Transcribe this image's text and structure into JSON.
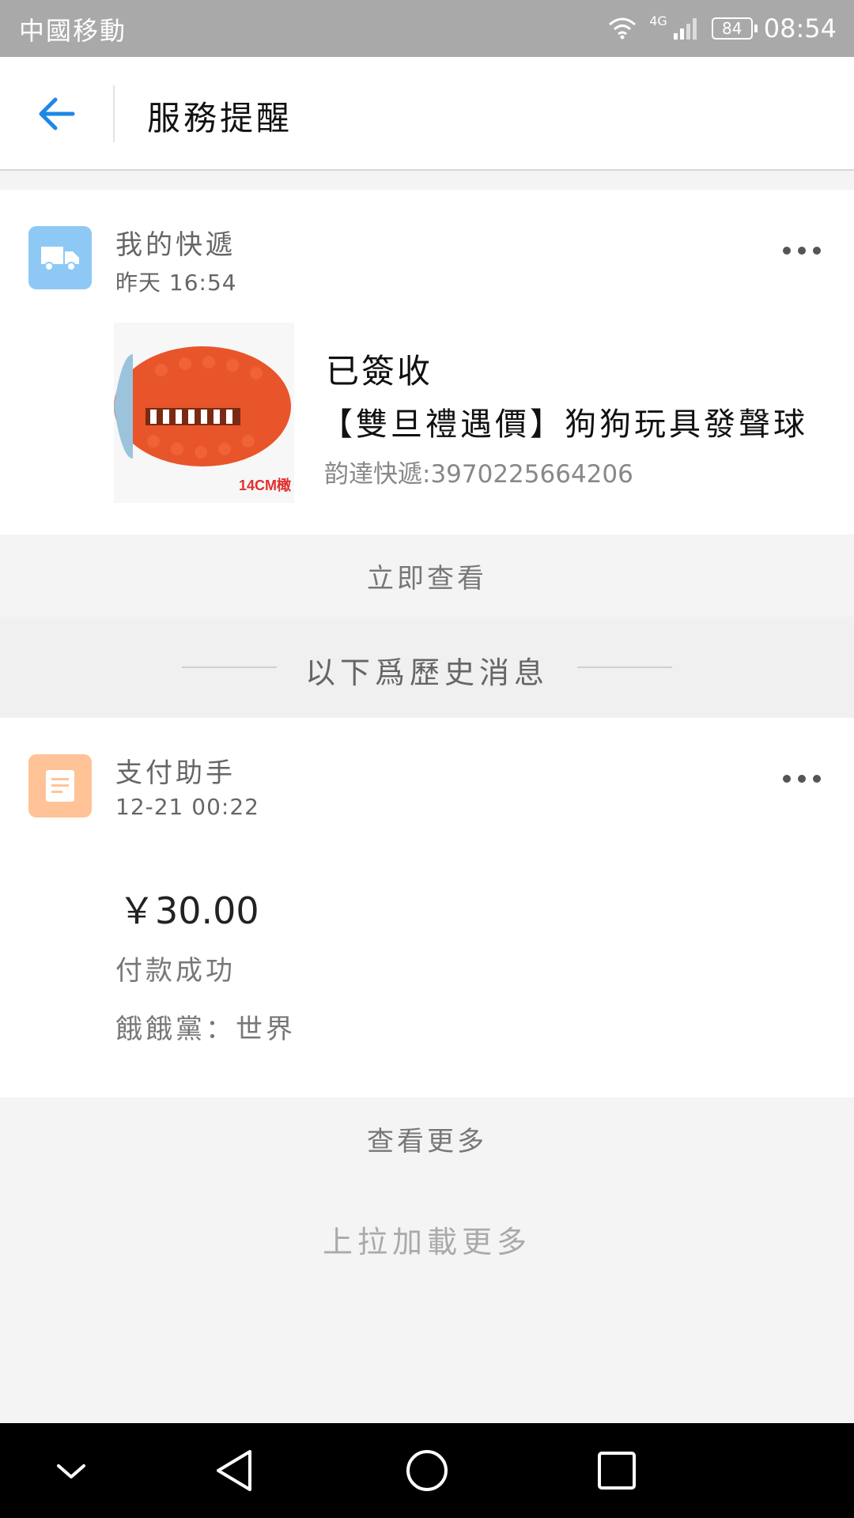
{
  "status_bar": {
    "carrier": "中國移動",
    "network": "4G",
    "battery": "84",
    "time": "08:54"
  },
  "header": {
    "title": "服務提醒"
  },
  "delivery_card": {
    "source": "我的快遞",
    "time": "昨天 16:54",
    "status": "已簽收",
    "item": "【雙旦禮遇價】狗狗玩具發聲球",
    "tracking": "韵達快遞:3970225664206",
    "thumb_label": "14CM橄",
    "action": "立即查看",
    "icon_color": "#8ec9f5"
  },
  "history_separator": "以下爲歷史消息",
  "payment_card": {
    "source": "支付助手",
    "time": "12-21 00:22",
    "amount": "￥30.00",
    "status": "付款成功",
    "merchant": "餓餓黨：世界",
    "action": "查看更多",
    "icon_color": "#ffc397"
  },
  "footer": {
    "load_more": "上拉加載更多"
  }
}
